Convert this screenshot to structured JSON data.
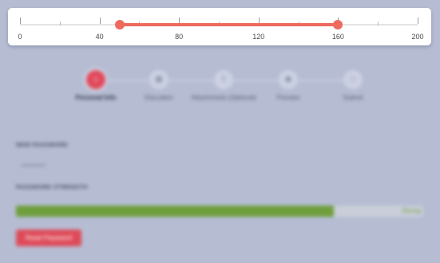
{
  "slider": {
    "min": 0,
    "max": 200,
    "minor_step": 20,
    "low_value": 50,
    "high_value": 160,
    "tick_labels": [
      "0",
      "40",
      "80",
      "120",
      "160",
      "200"
    ],
    "accent_color": "#ee6a5e"
  },
  "steps": [
    {
      "label": "Personal Info",
      "icon": "user-icon",
      "glyph": "⌂",
      "active": true
    },
    {
      "label": "Education",
      "icon": "grid-icon",
      "glyph": "▦",
      "active": false
    },
    {
      "label": "Attachments (Optional)",
      "icon": "attachment-icon",
      "glyph": "‡",
      "active": false
    },
    {
      "label": "Preview",
      "icon": "eye-icon",
      "glyph": "◉",
      "active": false
    },
    {
      "label": "Submit",
      "icon": "document-icon",
      "glyph": "□",
      "active": false
    }
  ],
  "form": {
    "new_password_label": "NEW PASSWORD",
    "new_password_value": "••••••••",
    "strength_label": "PASSWORD STRENGTH",
    "strength_level": 0.78,
    "strength_text": "Strong",
    "strength_color": "#6f9e3c",
    "reset_button_label": "Reset Password",
    "button_color": "#de4a58"
  }
}
